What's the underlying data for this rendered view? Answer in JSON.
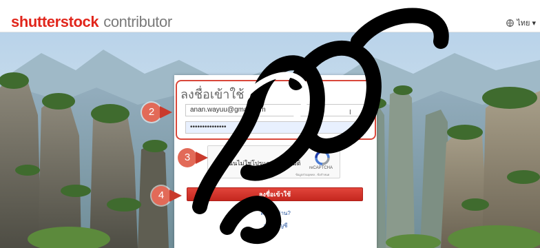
{
  "header": {
    "logo_bold": "shutterstock",
    "logo_light": "contributor",
    "language_label": "ไทย ▾"
  },
  "login": {
    "title": "ลงชื่อเข้าใช้",
    "email_value": "anan.wayuu@gmail.com",
    "password_value": "•••••••••••••••",
    "captcha_label": "ฉันไม่ใช่โปรแกรมอัตโนมัติ",
    "captcha_brand": "reCAPTCHA",
    "captcha_terms": "ข้อมูลส่วนบุคคล - ข้อกำหนด",
    "submit_label": "ลงชื่อเข้าใช้",
    "forgot_label": "ลืมรหัสผ่าน?",
    "signup_label": "สร้างบัญชี"
  },
  "steps": {
    "step2": "2",
    "step3": "3",
    "step4": "4"
  },
  "colors": {
    "brand_red": "#e1261c",
    "marker": "#e26a58",
    "link": "#1f4e9a"
  }
}
